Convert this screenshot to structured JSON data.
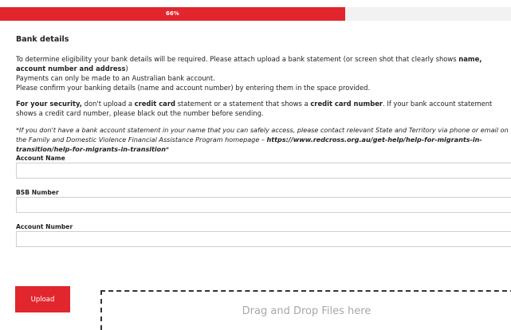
{
  "progress": {
    "percent_label": "66%",
    "value": 0.675
  },
  "bank": {
    "title": "Bank details",
    "p1_a": "To determine eligibility your bank details will be required. Please attach upload a bank statement (or screen shot that clearly shows ",
    "p1_b": "name, account number and address",
    "p1_c": ")",
    "p2": "Payments can only be made to an Australian bank account.",
    "p3": "Please confirm your banking details (name and account number) by entering them in the space provided.",
    "security_a": "For your security,",
    "security_b": " don't upload a ",
    "security_c": "credit card",
    "security_d": " statement or a statement that shows a ",
    "security_e": "credit card number",
    "security_f": ". If your bank account statement shows a credit card number, please black out the number before sending.",
    "note_a": "*If you don't have a bank account statement in your name that you can safely access, please contact relevant State and Territory via phone or email on the Family and Domestic Violence Financial Assistance Program homepage – ",
    "note_b": "https://www.redcross.org.au/get-help/help-for-migrants-in-transition/help-for-migrants-in-transition",
    "note_c": "*"
  },
  "fields": {
    "account_name_label": "Account Name",
    "account_name_value": "",
    "bsb_label": "BSB Number",
    "bsb_value": "",
    "account_number_label": "Account Number",
    "account_number_value": ""
  },
  "upload": {
    "button_label": "Upload",
    "dropzone_text": "Drag and Drop Files here"
  },
  "colors": {
    "accent": "#e1262d"
  }
}
